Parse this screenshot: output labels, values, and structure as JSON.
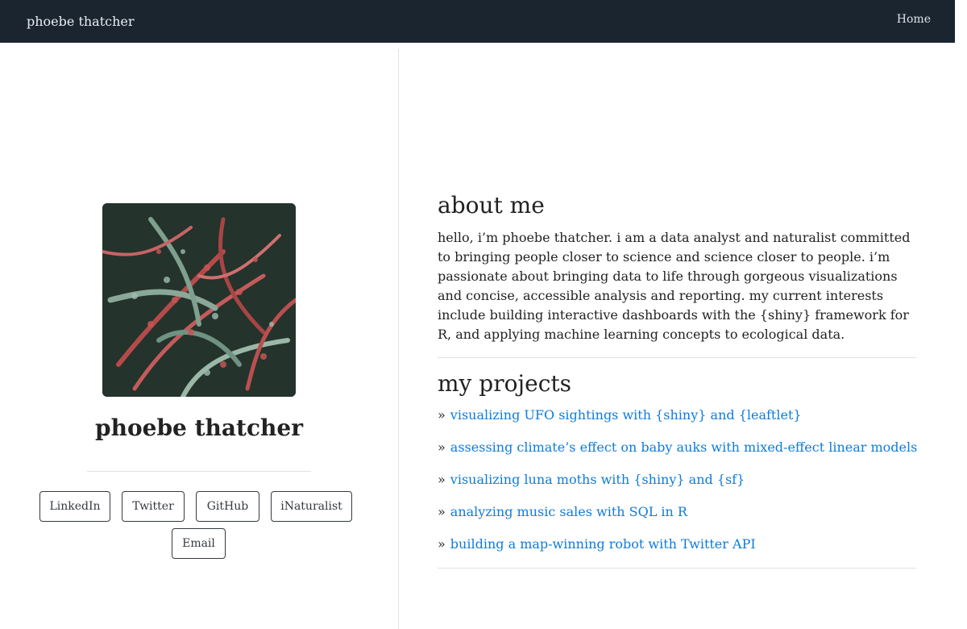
{
  "navbar": {
    "brand": "phoebe thatcher",
    "home_link": "Home"
  },
  "profile": {
    "name": "phoebe thatcher",
    "photo_alt": "photo of red and green fern-like plant",
    "links": [
      {
        "label": "LinkedIn"
      },
      {
        "label": "Twitter"
      },
      {
        "label": "GitHub"
      },
      {
        "label": "iNaturalist"
      },
      {
        "label": "Email"
      }
    ]
  },
  "about": {
    "heading": "about me",
    "text": "hello, i’m phoebe thatcher. i am a data analyst and naturalist committed to bringing people closer to science and science closer to people. i’m passionate about bringing data to life through gorgeous visualizations and concise, accessible analysis and reporting. my current interests include building interactive dashboards with the {shiny} framework for R, and applying machine learning concepts to ecological data."
  },
  "projects": {
    "heading": "my projects",
    "bullet": "»",
    "items": [
      {
        "label": "visualizing UFO sightings with {shiny} and {leaftlet}"
      },
      {
        "label": "assessing climate’s effect on baby auks with mixed-effect linear models"
      },
      {
        "label": "visualizing luna moths with {shiny} and {sf}"
      },
      {
        "label": "analyzing music sales with SQL in R"
      },
      {
        "label": "building a map-winning robot with Twitter API"
      }
    ]
  },
  "colors": {
    "navbar_bg": "#1b2530",
    "link": "#0d7bdc",
    "rule": "#dee2e6"
  }
}
